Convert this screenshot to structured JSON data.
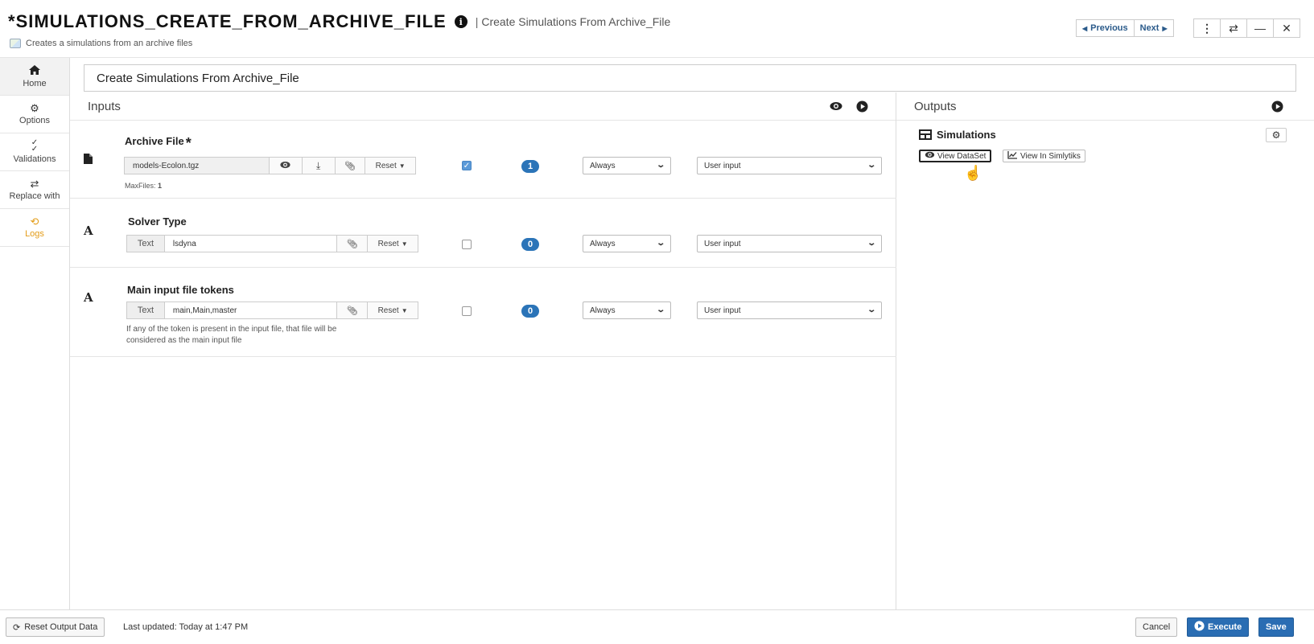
{
  "header": {
    "prefix": "*",
    "title": "SIMULATIONS_CREATE_FROM_ARCHIVE_FILE",
    "separator": "|",
    "subtitle": "Create Simulations From Archive_File",
    "description": "Creates a simulations from an archive files",
    "prev_label": "Previous",
    "next_label": "Next"
  },
  "sidebar": {
    "items": [
      {
        "label": "Home",
        "icon": "home-icon"
      },
      {
        "label": "Options",
        "icon": "gear-icon"
      },
      {
        "label": "Validations",
        "icon": "check-double-icon"
      },
      {
        "label": "Replace with",
        "icon": "swap-icon"
      },
      {
        "label": "Logs",
        "icon": "history-icon"
      }
    ]
  },
  "task_name": "Create Simulations From Archive_File",
  "inputs": {
    "heading": "Inputs",
    "rows": [
      {
        "label": "Archive File",
        "required_mark": "*",
        "value": "models-Ecolon.tgz",
        "reset_label": "Reset",
        "maxfiles_label": "MaxFiles:",
        "maxfiles_value": "1",
        "checked": true,
        "count": "1",
        "condition": "Always",
        "source": "User input"
      },
      {
        "label": "Solver Type",
        "type_label": "Text",
        "value": "lsdyna",
        "reset_label": "Reset",
        "checked": false,
        "count": "0",
        "condition": "Always",
        "source": "User input"
      },
      {
        "label": "Main input file tokens",
        "type_label": "Text",
        "value": "main,Main,master",
        "reset_label": "Reset",
        "hint_line1": "If any of the token is present in the input file, that file will be",
        "hint_line2": "considered as the main input file",
        "checked": false,
        "count": "0",
        "condition": "Always",
        "source": "User input"
      }
    ]
  },
  "outputs": {
    "heading": "Outputs",
    "item_title": "Simulations",
    "view_dataset_label": "View DataSet",
    "view_simlytiks_label": "View In Simlytiks"
  },
  "footer": {
    "reset_output_label": "Reset Output Data",
    "last_updated": "Last updated: Today at 1:47 PM",
    "cancel_label": "Cancel",
    "execute_label": "Execute",
    "save_label": "Save"
  },
  "colors": {
    "accent": "#2a6db3",
    "logs": "#e39c18",
    "badge": "#2b74b8"
  }
}
